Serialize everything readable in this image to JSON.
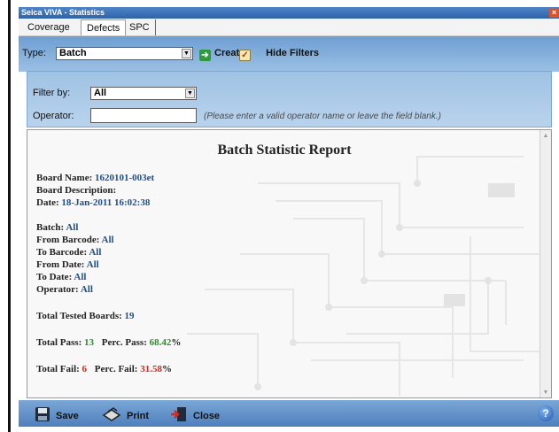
{
  "window": {
    "title": "Seica VIVA - Statistics"
  },
  "tabs": [
    {
      "label": "Coverage"
    },
    {
      "label": "Defects"
    },
    {
      "label": "SPC"
    }
  ],
  "toolbar": {
    "type_label": "Type:",
    "type_value": "Batch",
    "create_label": "Create",
    "hide_filters_label": "Hide Filters"
  },
  "filters": {
    "filter_by_label": "Filter by:",
    "filter_by_value": "All",
    "operator_label": "Operator:",
    "operator_value": "",
    "operator_hint": "(Please enter a valid operator name or leave the field blank.)"
  },
  "report": {
    "title": "Batch Statistic Report",
    "board_name_label": "Board Name:",
    "board_name_value": "1620101-003et",
    "board_description_label": "Board Description:",
    "date_label": "Date:",
    "date_value": "18-Jan-2011 16:02:38",
    "batch_label": "Batch:",
    "batch_value": "All",
    "from_barcode_label": "From Barcode:",
    "from_barcode_value": "All",
    "to_barcode_label": "To Barcode:",
    "to_barcode_value": "All",
    "from_date_label": "From Date:",
    "from_date_value": "All",
    "to_date_label": "To Date:",
    "to_date_value": "All",
    "operator_label": "Operator:",
    "operator_value": "All",
    "total_tested_label": "Total Tested Boards:",
    "total_tested_value": "19",
    "total_pass_label": "Total Pass:",
    "total_pass_value": "13",
    "perc_pass_label": "Perc. Pass:",
    "perc_pass_value": "68.42",
    "total_fail_label": "Total Fail:",
    "total_fail_value": "6",
    "perc_fail_label": "Perc. Fail:",
    "perc_fail_value": "31.58",
    "percent_sign": "%"
  },
  "bottombar": {
    "save_label": "Save",
    "print_label": "Print",
    "close_label": "Close",
    "help_label": "?"
  },
  "colors": {
    "value_blue": "#1f4f8a",
    "pass_green": "#2e8b2e",
    "fail_red": "#d2291f"
  }
}
